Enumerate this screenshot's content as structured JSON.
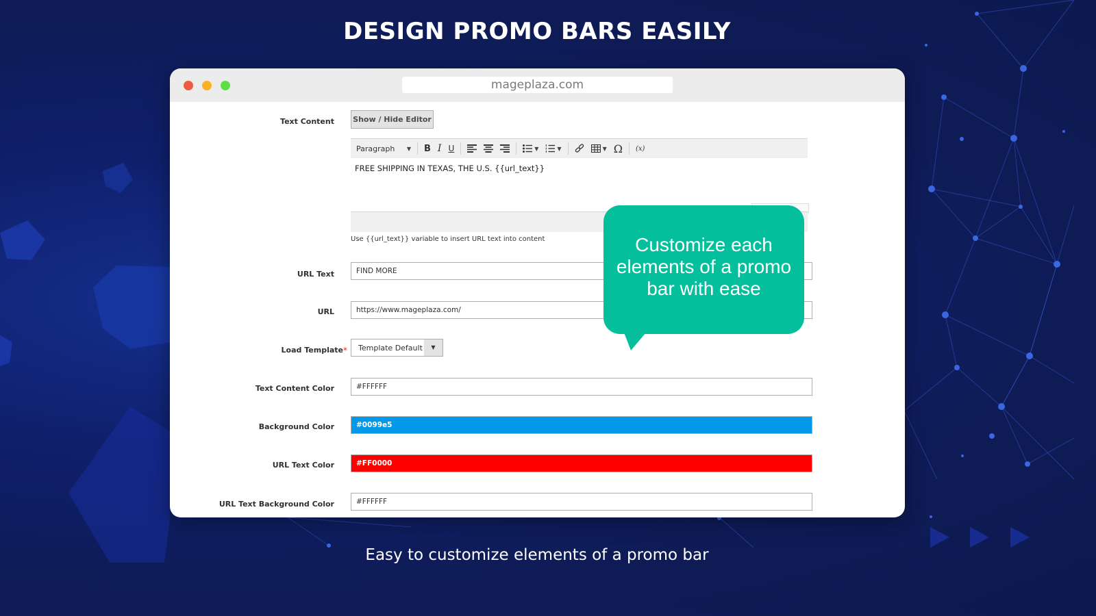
{
  "headline": "DESIGN PROMO BARS EASILY",
  "subline": "Easy to customize elements of a promo bar",
  "browser": {
    "address": "mageplaza.com"
  },
  "form": {
    "text_content_label": "Text Content",
    "show_hide_editor_label": "Show / Hide Editor",
    "toolbar": {
      "paragraph_label": "Paragraph",
      "bold": "B",
      "italic": "I",
      "underline": "U",
      "special_char": "Ω",
      "variable": "(x)"
    },
    "editor_content": "FREE SHIPPING IN TEXAS, THE U.S.  {{url_text}}",
    "editor_hint": "Use {{url_text}} variable to insert URL text into content",
    "url_text": {
      "label": "URL Text",
      "value": "FIND MORE"
    },
    "url": {
      "label": "URL",
      "value": "https://www.mageplaza.com/"
    },
    "load_template": {
      "label": "Load Template",
      "required_mark": "*",
      "value": "Template Default"
    },
    "text_content_color": {
      "label": "Text Content Color",
      "value": "#FFFFFF"
    },
    "background_color": {
      "label": "Background Color",
      "value": "#0099e5",
      "swatch": "#0499e8"
    },
    "url_text_color": {
      "label": "URL Text Color",
      "value": "#FF0000",
      "swatch": "#ff0000"
    },
    "url_text_background_color": {
      "label": "URL Text Background Color",
      "value": "#FFFFFF"
    }
  },
  "callout": {
    "text": "Customize each elements of a promo bar with ease",
    "color": "#05bf9c"
  }
}
